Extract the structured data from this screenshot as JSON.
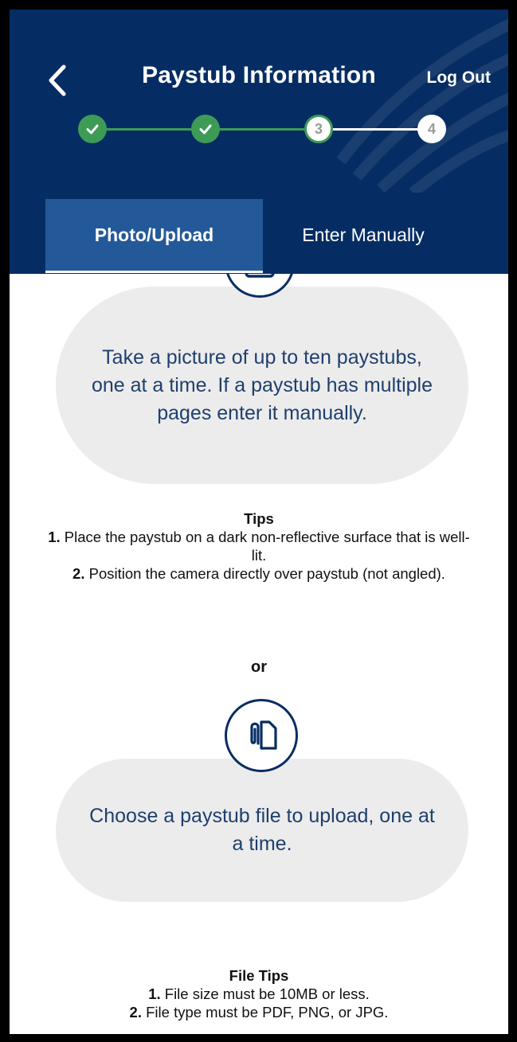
{
  "header": {
    "title": "Paystub Information",
    "logout_label": "Log Out",
    "steps": [
      {
        "state": "done"
      },
      {
        "state": "done"
      },
      {
        "state": "current",
        "label": "3"
      },
      {
        "state": "todo",
        "label": "4"
      }
    ]
  },
  "tabs": {
    "photo_label": "Photo/Upload",
    "manual_label": "Enter Manually",
    "active": "photo"
  },
  "camera": {
    "text": "Take a picture of up to ten paystubs, one at a time. If a paystub has multiple pages enter it manually."
  },
  "tips": {
    "heading": "Tips",
    "items": [
      {
        "num": "1.",
        "text": "Place the paystub on a dark non-reflective surface that is well-lit."
      },
      {
        "num": "2.",
        "text": "Position the camera directly over paystub (not angled)."
      }
    ]
  },
  "or_label": "or",
  "upload": {
    "text": "Choose a paystub file to upload, one at a time."
  },
  "file_tips": {
    "heading": "File Tips",
    "items": [
      {
        "num": "1.",
        "text": "File size must be 10MB or less."
      },
      {
        "num": "2.",
        "text": "File type must be PDF, PNG, or JPG."
      }
    ]
  },
  "colors": {
    "navy": "#062d63",
    "active_tab": "#245999",
    "step_done": "#3e9b55",
    "pill_bg": "#ececec",
    "pill_text": "#1f3f6e"
  },
  "icons": {
    "back": "chevron-left-icon",
    "step_done": "check-icon",
    "camera": "camera-icon",
    "upload": "paperclip-file-icon"
  }
}
